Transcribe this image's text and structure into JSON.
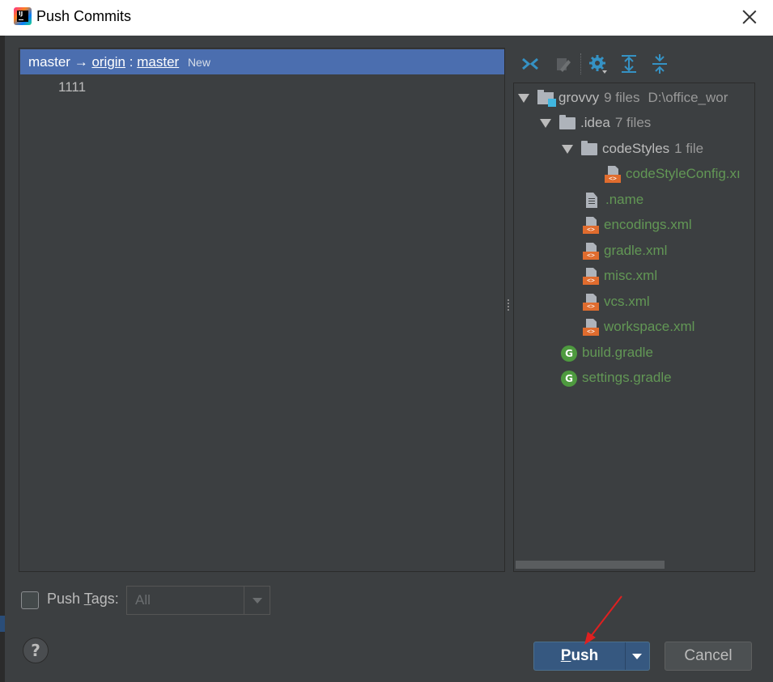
{
  "window": {
    "title": "Push Commits"
  },
  "branch": {
    "local": "master",
    "arrow": "→",
    "remote": "origin",
    "separator": ":",
    "remote_branch": "master",
    "badge": "New"
  },
  "commits": [
    {
      "message": "1111"
    }
  ],
  "toolbar": {
    "icons": [
      "expand-collapse-icon",
      "edit-source-icon",
      "settings-icon",
      "expand-all-icon",
      "collapse-all-icon"
    ]
  },
  "tree": {
    "root": {
      "name": "grovvy",
      "meta": "9 files",
      "path": "D:\\office_wor"
    },
    "idea": {
      "name": ".idea",
      "meta": "7 files"
    },
    "codestyles": {
      "name": "codeStyles",
      "meta": "1 file"
    },
    "files": {
      "codestyleconfig": "codeStyleConfig.xı",
      "name": ".name",
      "encodings": "encodings.xml",
      "gradle": "gradle.xml",
      "misc": "misc.xml",
      "vcs": "vcs.xml",
      "workspace": "workspace.xml",
      "build_gradle": "build.gradle",
      "settings_gradle": "settings.gradle"
    },
    "xml_badge": "<>",
    "gradle_glyph": "G"
  },
  "tags": {
    "label_before": "Push ",
    "label_underlined": "T",
    "label_after": "ags:",
    "selected": "All"
  },
  "buttons": {
    "help": "?",
    "push_underlined": "P",
    "push_rest": "ush",
    "cancel": "Cancel"
  },
  "colors": {
    "accent": "#4b6eaf",
    "push_button": "#365880",
    "file_added": "#629755",
    "xml_badge": "#e06c2e",
    "annotation_arrow": "#e02020"
  }
}
